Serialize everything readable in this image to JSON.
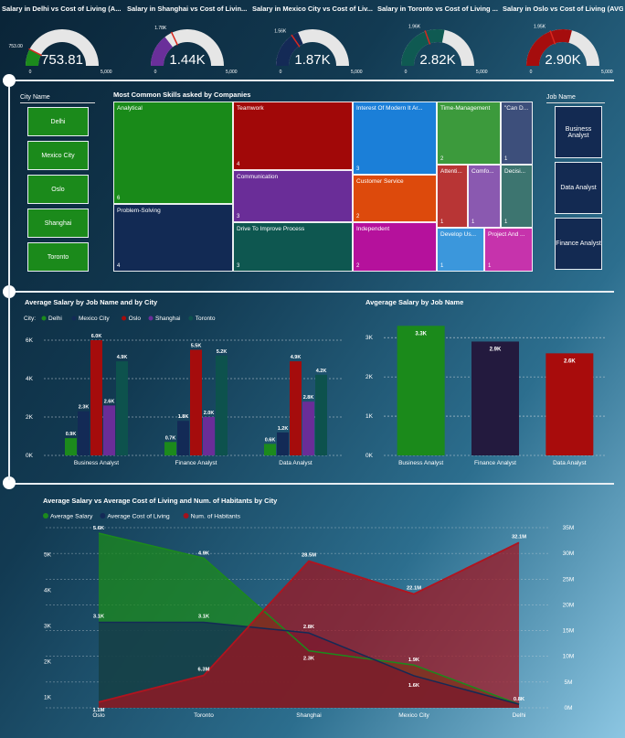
{
  "gauges": [
    {
      "title": "Salary in Delhi vs Cost of Living (A...",
      "value": "753.81",
      "target_label": "753.00",
      "min": "0",
      "max": "5,000",
      "fill": 0.15,
      "target": 0.15,
      "color": "#1c8a1c"
    },
    {
      "title": "Salary in Shanghai vs Cost of Livin...",
      "value": "1.44K",
      "target_label": "1.78K",
      "min": "0",
      "max": "5,000",
      "fill": 0.29,
      "target": 0.36,
      "color": "#6a2f9a"
    },
    {
      "title": "Salary in Mexico City vs Cost of Liv...",
      "value": "1.87K",
      "target_label": "1.56K",
      "min": "0",
      "max": "5,000",
      "fill": 0.37,
      "target": 0.31,
      "color": "#142a56"
    },
    {
      "title": "Salary in Toronto vs Cost of Living ...",
      "value": "2.82K",
      "target_label": "1.96K",
      "min": "0",
      "max": "5,000",
      "fill": 0.56,
      "target": 0.39,
      "color": "#0f5a52"
    },
    {
      "title": "Salary in Oslo vs Cost of Living (AVG)",
      "value": "2.90K",
      "target_label": "1.95K",
      "min": "0",
      "max": "5,000",
      "fill": 0.58,
      "target": 0.39,
      "color": "#a50d0d"
    }
  ],
  "city_slicer": {
    "title": "City Name",
    "items": [
      "Delhi",
      "Mexico City",
      "Oslo",
      "Shanghai",
      "Toronto"
    ]
  },
  "job_slicer": {
    "title": "Job Name",
    "items": [
      "Business Analyst",
      "Data Analyst",
      "Finance Analyst"
    ]
  },
  "treemap": {
    "title": "Most Common Skills asked by Companies",
    "cells": [
      {
        "label": "Analytical",
        "count": "6",
        "color": "#198a19"
      },
      {
        "label": "Problem-Solving",
        "count": "4",
        "color": "#122a54"
      },
      {
        "label": "Teamwork",
        "count": "4",
        "color": "#a10808"
      },
      {
        "label": "Communication",
        "count": "3",
        "color": "#6a2d98"
      },
      {
        "label": "Drive To Improve Process",
        "count": "3",
        "color": "#0e5750"
      },
      {
        "label": "Interest Of Modern It Ar...",
        "count": "3",
        "color": "#1b7fd8"
      },
      {
        "label": "Customer Service",
        "count": "2",
        "color": "#dd4a0c"
      },
      {
        "label": "Independent",
        "count": "2",
        "color": "#b5119c"
      },
      {
        "label": "Time-Management",
        "count": "2",
        "color": "#3c9a3c"
      },
      {
        "label": "\"Can D...",
        "count": "1",
        "color": "#3d4f7b"
      },
      {
        "label": "Attenti...",
        "count": "1",
        "color": "#b83535"
      },
      {
        "label": "Comfo...",
        "count": "1",
        "color": "#8a59b0"
      },
      {
        "label": "Decisi...",
        "count": "1",
        "color": "#3d7570"
      },
      {
        "label": "Develop Us...",
        "count": "1",
        "color": "#3b97dc"
      },
      {
        "label": "Project And ...",
        "count": "1",
        "color": "#c633ac"
      }
    ]
  },
  "chart_data": [
    {
      "type": "bar",
      "title": "Average Salary by Job Name and by City",
      "legend_title": "City:",
      "legend": "top-left",
      "categories": [
        "Business Analyst",
        "Finance Analyst",
        "Data Analyst"
      ],
      "ylim": [
        0,
        6000
      ],
      "yticks": [
        "0K",
        "2K",
        "4K",
        "6K"
      ],
      "series": [
        {
          "name": "Delhi",
          "color": "#1c8a1c",
          "values": [
            900,
            700,
            600
          ],
          "labels": [
            "0.9K",
            "0.7K",
            "0.6K"
          ]
        },
        {
          "name": "Mexico City",
          "color": "#132a56",
          "values": [
            2300,
            1800,
            1200
          ],
          "labels": [
            "2.3K",
            "1.8K",
            "1.2K"
          ]
        },
        {
          "name": "Oslo",
          "color": "#a50c0c",
          "values": [
            6000,
            5500,
            4900
          ],
          "labels": [
            "6.0K",
            "5.5K",
            "4.9K"
          ]
        },
        {
          "name": "Shanghai",
          "color": "#6a2d98",
          "values": [
            2600,
            2000,
            2800
          ],
          "labels": [
            "2.6K",
            "2.0K",
            "2.8K"
          ]
        },
        {
          "name": "Toronto",
          "color": "#0d524d",
          "values": [
            4900,
            5200,
            4200
          ],
          "labels": [
            "4.9K",
            "5.2K",
            "4.2K"
          ]
        }
      ],
      "grid": true
    },
    {
      "type": "bar",
      "title": "Avgerage Salary by Job Name",
      "categories": [
        "Business Analyst",
        "Finance Analyst",
        "Data Analyst"
      ],
      "values": [
        3300,
        2900,
        2600
      ],
      "labels": [
        "3.3K",
        "2.9K",
        "2.6K"
      ],
      "colors": [
        "#1b8a1b",
        "#231a3e",
        "#a80c0c"
      ],
      "ylim": [
        0,
        3400
      ],
      "yticks": [
        "0K",
        "1K",
        "2K",
        "3K"
      ],
      "grid": true
    },
    {
      "type": "area",
      "title": "Average Salary vs Average Cost of Living and Num. of Habitants by City",
      "legend": "top-left",
      "categories": [
        "Oslo",
        "Toronto",
        "Shanghai",
        "Mexico City",
        "Delhi"
      ],
      "left_axis": {
        "ylim": [
          700,
          5600
        ],
        "ticks": [
          "1K",
          "2K",
          "3K",
          "4K",
          "5K"
        ]
      },
      "right_axis": {
        "ylim": [
          0,
          35000000
        ],
        "ticks": [
          "0M",
          "5M",
          "10M",
          "15M",
          "20M",
          "25M",
          "30M",
          "35M"
        ]
      },
      "series": [
        {
          "name": "Average Salary",
          "color": "#1c8a1c",
          "axis": "left",
          "values": [
            5600,
            4900,
            2300,
            1900,
            800
          ],
          "labels": [
            "5.6K",
            "4.9K",
            "2.3K",
            "1.9K",
            "0.8K"
          ]
        },
        {
          "name": "Average Cost of Living",
          "color": "#142a56",
          "axis": "left",
          "values": [
            3100,
            3100,
            2800,
            1600,
            800
          ],
          "labels": [
            "3.1K",
            "3.1K",
            "2.8K",
            "1.6K",
            ""
          ]
        },
        {
          "name": "Num. of Habitants",
          "color": "#a2121d",
          "axis": "right",
          "values": [
            1100000,
            6300000,
            28500000,
            22100000,
            32100000
          ],
          "labels": [
            "1.1M",
            "6.3M",
            "28.5M",
            "22.1M",
            "32.1M"
          ]
        }
      ],
      "grid": true
    }
  ]
}
